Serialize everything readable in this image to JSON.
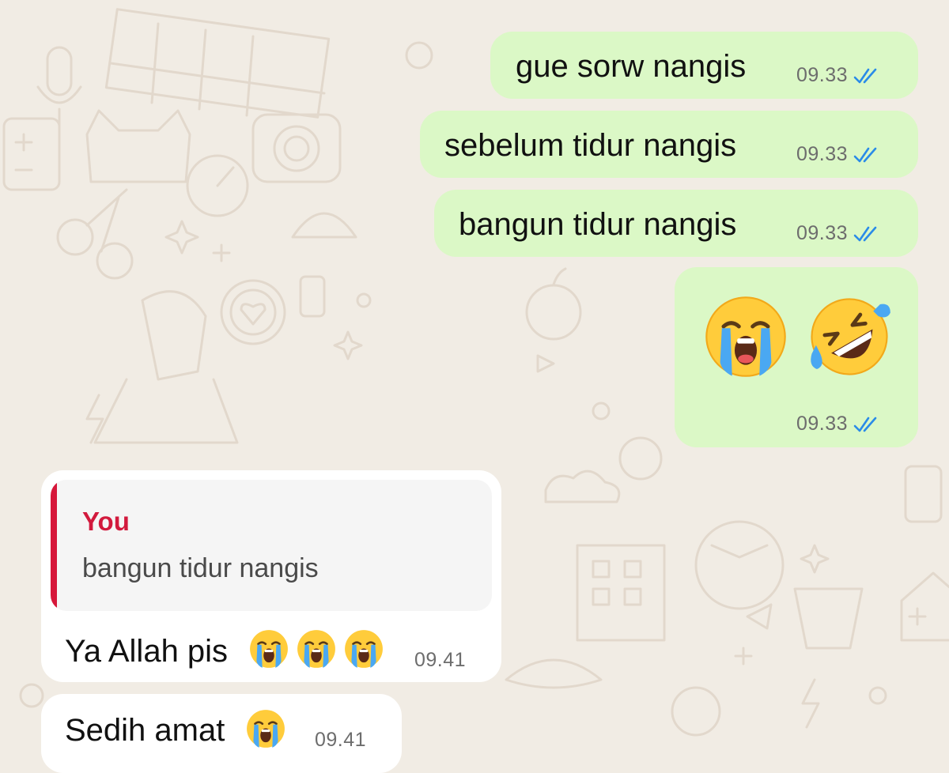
{
  "messages": [
    {
      "direction": "outgoing",
      "text": "gue sorw nangis",
      "time": "09.33",
      "status": "read"
    },
    {
      "direction": "outgoing",
      "text": "sebelum tidur nangis",
      "time": "09.33",
      "status": "read"
    },
    {
      "direction": "outgoing",
      "text": "bangun tidur nangis",
      "time": "09.33",
      "status": "read"
    },
    {
      "direction": "outgoing",
      "text": "",
      "emojis": [
        "loudly-crying-face",
        "rolling-on-floor-laughing"
      ],
      "time": "09.33",
      "status": "read"
    },
    {
      "direction": "incoming",
      "reply": {
        "author": "You",
        "text": "bangun tidur nangis"
      },
      "text": "Ya Allah pis",
      "emojis": [
        "loudly-crying-face",
        "loudly-crying-face",
        "loudly-crying-face"
      ],
      "time": "09.41"
    },
    {
      "direction": "incoming",
      "text": "Sedih amat",
      "emojis": [
        "loudly-crying-face"
      ],
      "time": "09.41"
    }
  ],
  "colors": {
    "background": "#f1ece4",
    "outgoing_bubble": "#dbf8c6",
    "incoming_bubble": "#ffffff",
    "read_ticks": "#2a8be8",
    "reply_accent": "#d6173a",
    "timestamp": "#6d6d6d"
  },
  "icons": {
    "read_receipt": "double-check-icon",
    "wallpaper": "doodle-pattern"
  }
}
